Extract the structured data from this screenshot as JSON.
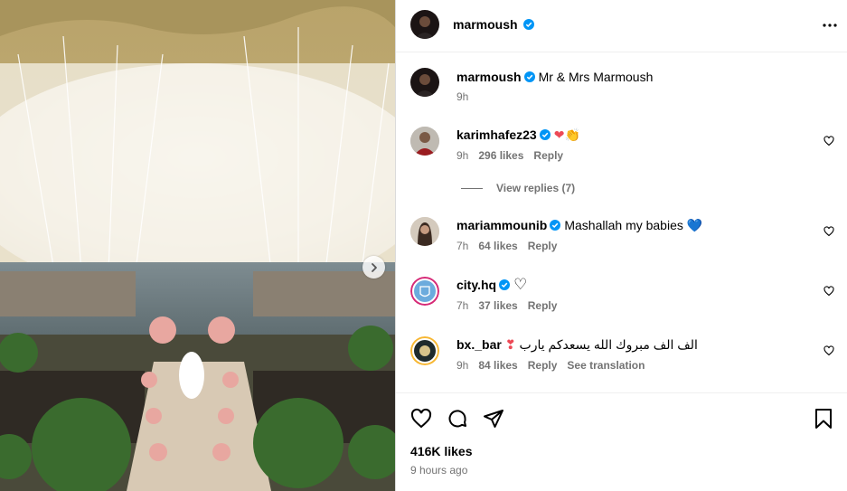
{
  "post": {
    "author": "marmoush",
    "caption": "Mr & Mrs Marmoush",
    "caption_time": "9h",
    "likes": "416K likes",
    "time_ago": "9 hours ago"
  },
  "comments": [
    {
      "user": "karimhafez23",
      "text": "",
      "emoji": "❤👏",
      "time": "9h",
      "likes": "296 likes",
      "reply": "Reply"
    },
    {
      "user": "mariammounib",
      "text": "Mashallah my babies",
      "emoji": "💙",
      "time": "7h",
      "likes": "64 likes",
      "reply": "Reply"
    },
    {
      "user": "city.hq",
      "text": "",
      "emoji": "♡",
      "time": "7h",
      "likes": "37 likes",
      "reply": "Reply"
    },
    {
      "user": "bx._bar",
      "text": "الف الف مبروك الله يسعدكم يارب",
      "emoji": "❣",
      "time": "9h",
      "likes": "84 likes",
      "reply": "Reply",
      "translate": "See translation"
    }
  ],
  "view_replies": "View replies (7)",
  "colors": {
    "verified": "#0095f6",
    "muted": "#737373",
    "heart_red": "#ed4956",
    "blue_heart": "#1d6fe0"
  }
}
